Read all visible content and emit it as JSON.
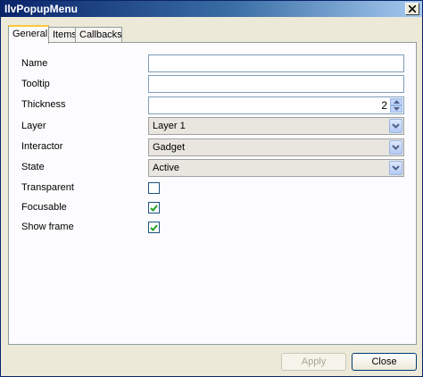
{
  "window": {
    "title": "IlvPopupMenu"
  },
  "tabs": [
    {
      "label": "General",
      "active": true
    },
    {
      "label": "Items",
      "active": false
    },
    {
      "label": "Callbacks",
      "active": false
    }
  ],
  "form": {
    "name_label": "Name",
    "name_value": "",
    "tooltip_label": "Tooltip",
    "tooltip_value": "",
    "thickness_label": "Thickness",
    "thickness_value": "2",
    "layer_label": "Layer",
    "layer_value": "Layer 1",
    "interactor_label": "Interactor",
    "interactor_value": "Gadget",
    "state_label": "State",
    "state_value": "Active",
    "transparent_label": "Transparent",
    "transparent_checked": false,
    "focusable_label": "Focusable",
    "focusable_checked": true,
    "showframe_label": "Show frame",
    "showframe_checked": true
  },
  "buttons": {
    "apply": "Apply",
    "close": "Close"
  },
  "colors": {
    "check_green": "#21a121",
    "title_start": "#0a246a",
    "tab_highlight": "#ffc83c"
  }
}
